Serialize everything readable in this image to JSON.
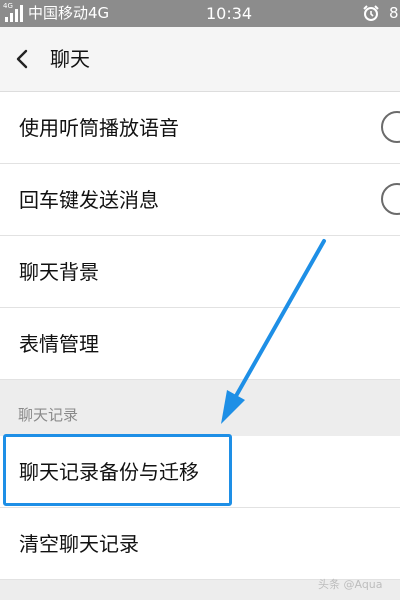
{
  "status_bar": {
    "network_tag": "4G",
    "carrier": "中国移动4G",
    "time": "10:34",
    "battery_text": "8",
    "icons": [
      "signal-icon",
      "alarm-clock-icon"
    ]
  },
  "nav": {
    "title": "聊天",
    "back_icon": "chevron-left-icon"
  },
  "settings": {
    "group1": [
      {
        "label": "使用听筒播放语音",
        "toggle": false
      },
      {
        "label": "回车键发送消息",
        "toggle": false
      },
      {
        "label": "聊天背景"
      },
      {
        "label": "表情管理"
      }
    ],
    "section_header": "聊天记录",
    "group2": [
      {
        "label": "聊天记录备份与迁移",
        "highlighted": true
      },
      {
        "label": "清空聊天记录"
      }
    ]
  },
  "annotation": {
    "color": "#1e8fe6",
    "arrow_icon": "arrow-pointer-icon"
  },
  "watermark": "头条 @Aqua"
}
